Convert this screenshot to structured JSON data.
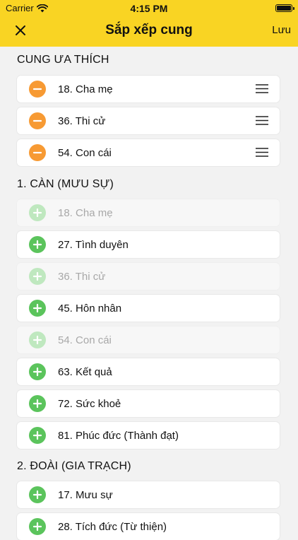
{
  "status": {
    "carrier": "Carrier",
    "time": "4:15 PM"
  },
  "nav": {
    "title": "Sắp xếp cung",
    "save_label": "Lưu"
  },
  "favorites": {
    "header": "CUNG ƯA THÍCH",
    "items": [
      {
        "label": "18. Cha mẹ"
      },
      {
        "label": "36. Thi cử"
      },
      {
        "label": "54. Con cái"
      }
    ]
  },
  "sections": [
    {
      "header": "1. CÀN (MƯU SỰ)",
      "items": [
        {
          "label": "18. Cha mẹ",
          "enabled": false
        },
        {
          "label": "27. Tình duyên",
          "enabled": true
        },
        {
          "label": "36. Thi cử",
          "enabled": false
        },
        {
          "label": "45. Hôn nhân",
          "enabled": true
        },
        {
          "label": "54. Con cái",
          "enabled": false
        },
        {
          "label": "63. Kết quả",
          "enabled": true
        },
        {
          "label": "72. Sức khoẻ",
          "enabled": true
        },
        {
          "label": "81. Phúc đức (Thành đạt)",
          "enabled": true
        }
      ]
    },
    {
      "header": "2. ĐOÀI (GIA TRẠCH)",
      "items": [
        {
          "label": "17. Mưu sự",
          "enabled": true
        },
        {
          "label": "28. Tích đức (Từ thiện)",
          "enabled": true
        }
      ]
    }
  ],
  "colors": {
    "navbar": "#f9d423",
    "remove": "#f79a33",
    "add": "#5bc45c",
    "add_disabled": "#bfe8bf"
  }
}
